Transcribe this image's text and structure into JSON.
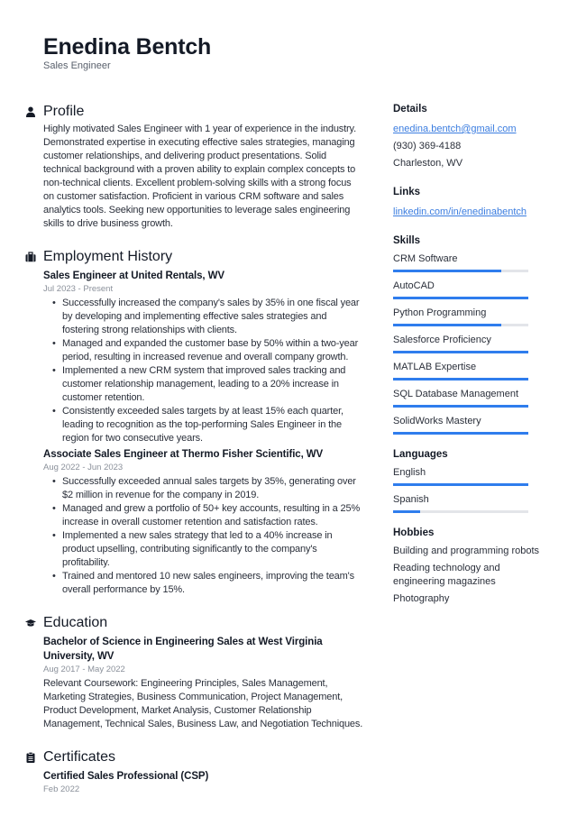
{
  "header": {
    "name": "Enedina Bentch",
    "title": "Sales Engineer"
  },
  "profile": {
    "heading": "Profile",
    "icon": "person-icon",
    "text": "Highly motivated Sales Engineer with 1 year of experience in the industry. Demonstrated expertise in executing effective sales strategies, managing customer relationships, and delivering product presentations. Solid technical background with a proven ability to explain complex concepts to non-technical clients. Excellent problem-solving skills with a strong focus on customer satisfaction. Proficient in various CRM software and sales analytics tools. Seeking new opportunities to leverage sales engineering skills to drive business growth."
  },
  "employment": {
    "heading": "Employment History",
    "icon": "briefcase-icon",
    "jobs": [
      {
        "title": "Sales Engineer at United Rentals, WV",
        "dates": "Jul 2023 - Present",
        "bullets": [
          "Successfully increased the company's sales by 35% in one fiscal year by developing and implementing effective sales strategies and fostering strong relationships with clients.",
          "Managed and expanded the customer base by 50% within a two-year period, resulting in increased revenue and overall company growth.",
          "Implemented a new CRM system that improved sales tracking and customer relationship management, leading to a 20% increase in customer retention.",
          "Consistently exceeded sales targets by at least 15% each quarter, leading to recognition as the top-performing Sales Engineer in the region for two consecutive years."
        ]
      },
      {
        "title": "Associate Sales Engineer at Thermo Fisher Scientific, WV",
        "dates": "Aug 2022 - Jun 2023",
        "bullets": [
          "Successfully exceeded annual sales targets by 35%, generating over $2 million in revenue for the company in 2019.",
          "Managed and grew a portfolio of 50+ key accounts, resulting in a 25% increase in overall customer retention and satisfaction rates.",
          "Implemented a new sales strategy that led to a 40% increase in product upselling, contributing significantly to the company's profitability.",
          "Trained and mentored 10 new sales engineers, improving the team's overall performance by 15%."
        ]
      }
    ]
  },
  "education": {
    "heading": "Education",
    "icon": "graduation-cap-icon",
    "items": [
      {
        "title": "Bachelor of Science in Engineering Sales at West Virginia University, WV",
        "dates": "Aug 2017 - May 2022",
        "description": "Relevant Coursework: Engineering Principles, Sales Management, Marketing Strategies, Business Communication, Project Management, Product Development, Market Analysis, Customer Relationship Management, Technical Sales, Business Law, and Negotiation Techniques."
      }
    ]
  },
  "certificates": {
    "heading": "Certificates",
    "icon": "clipboard-icon",
    "items": [
      {
        "title": "Certified Sales Professional (CSP)",
        "date": "Feb 2022"
      }
    ]
  },
  "details": {
    "heading": "Details",
    "email": "enedina.bentch@gmail.com",
    "phone": "(930) 369-4188",
    "location": "Charleston, WV"
  },
  "links": {
    "heading": "Links",
    "items": [
      "linkedin.com/in/enedinabentch"
    ]
  },
  "skills": {
    "heading": "Skills",
    "items": [
      {
        "name": "CRM Software",
        "level": 0.8
      },
      {
        "name": "AutoCAD",
        "level": 1.0
      },
      {
        "name": "Python Programming",
        "level": 0.8
      },
      {
        "name": "Salesforce Proficiency",
        "level": 1.0
      },
      {
        "name": "MATLAB Expertise",
        "level": 1.0
      },
      {
        "name": "SQL Database Management",
        "level": 1.0
      },
      {
        "name": "SolidWorks Mastery",
        "level": 1.0
      }
    ]
  },
  "languages": {
    "heading": "Languages",
    "items": [
      {
        "name": "English",
        "level": 1.0
      },
      {
        "name": "Spanish",
        "level": 0.2
      }
    ]
  },
  "hobbies": {
    "heading": "Hobbies",
    "items": [
      "Building and programming robots",
      "Reading technology and engineering magazines",
      "Photography"
    ]
  },
  "colors": {
    "accent": "#2f7ded",
    "track": "#e3e5e9",
    "link": "#3b7de0"
  }
}
